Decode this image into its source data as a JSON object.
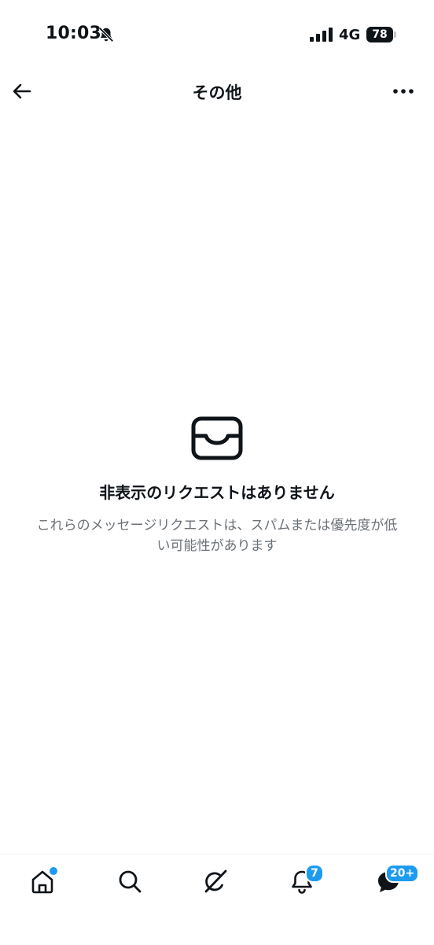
{
  "status_bar": {
    "time": "10:03",
    "network": "4G",
    "battery": "78"
  },
  "header": {
    "title": "その他"
  },
  "empty_state": {
    "title": "非表示のリクエストはありません",
    "description": "これらのメッセージリクエストは、スパムまたは優先度が低い可能性があります"
  },
  "bottom_nav": {
    "notifications_badge": "7",
    "messages_badge": "20+"
  },
  "colors": {
    "accent": "#1d9bf0",
    "text_primary": "#0f1419",
    "text_secondary": "#6b7177"
  },
  "icons": {
    "status": [
      "bell-off-icon",
      "signal-icon",
      "battery-icon"
    ],
    "header": [
      "back-arrow-icon",
      "more-icon"
    ],
    "empty": "inbox-icon",
    "nav": [
      "home-icon",
      "search-icon",
      "grok-icon",
      "bell-icon",
      "messages-icon"
    ]
  }
}
